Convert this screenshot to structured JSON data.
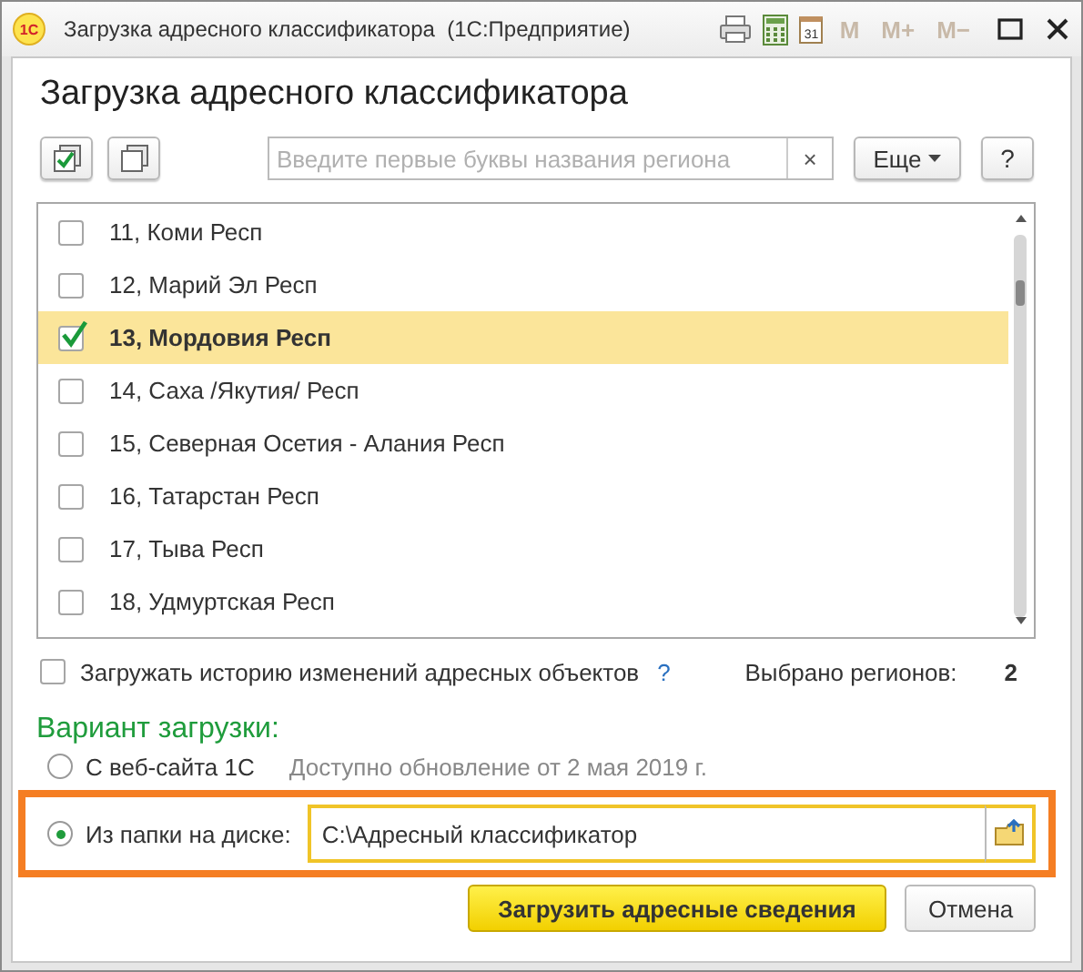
{
  "window": {
    "logo": "1С",
    "title": "Загрузка адресного классификатора  (1С:Предприятие)",
    "calendar_day": "31",
    "memory_buttons": [
      {
        "label": "M",
        "disabled": true
      },
      {
        "label": "M+",
        "disabled": true
      },
      {
        "label": "M−",
        "disabled": true
      }
    ]
  },
  "heading": "Загрузка адресного классификатора",
  "toolbar": {
    "search": {
      "placeholder": "Введите первые буквы названия региона"
    },
    "clear": "×",
    "more": "Еще",
    "help": "?"
  },
  "regions": [
    {
      "label": "11, Коми Респ",
      "checked": false,
      "selected": false
    },
    {
      "label": "12, Марий Эл Респ",
      "checked": false,
      "selected": false
    },
    {
      "label": "13, Мордовия Респ",
      "checked": true,
      "selected": true
    },
    {
      "label": "14, Саха /Якутия/ Респ",
      "checked": false,
      "selected": false
    },
    {
      "label": "15, Северная Осетия - Алания Респ",
      "checked": false,
      "selected": false
    },
    {
      "label": "16, Татарстан Респ",
      "checked": false,
      "selected": false
    },
    {
      "label": "17, Тыва Респ",
      "checked": false,
      "selected": false
    },
    {
      "label": "18, Удмуртская Респ",
      "checked": false,
      "selected": false
    }
  ],
  "history": {
    "label": "Загружать историю изменений адресных объектов",
    "checked": false,
    "help": "?"
  },
  "selected_count": {
    "label": "Выбрано регионов:",
    "value": "2"
  },
  "variant": {
    "title": "Вариант загрузки:",
    "options": [
      {
        "label": "С веб-сайта 1С",
        "selected": false,
        "highlighted": false,
        "note": "Доступно обновление от 2 мая 2019 г."
      },
      {
        "label": "Из папки на диске:",
        "selected": true,
        "highlighted": true,
        "path": "C:\\Адресный классификатор"
      }
    ]
  },
  "buttons": [
    {
      "label": "Загрузить адресные сведения",
      "kind": "primary"
    },
    {
      "label": "Отмена",
      "kind": "default"
    }
  ]
}
